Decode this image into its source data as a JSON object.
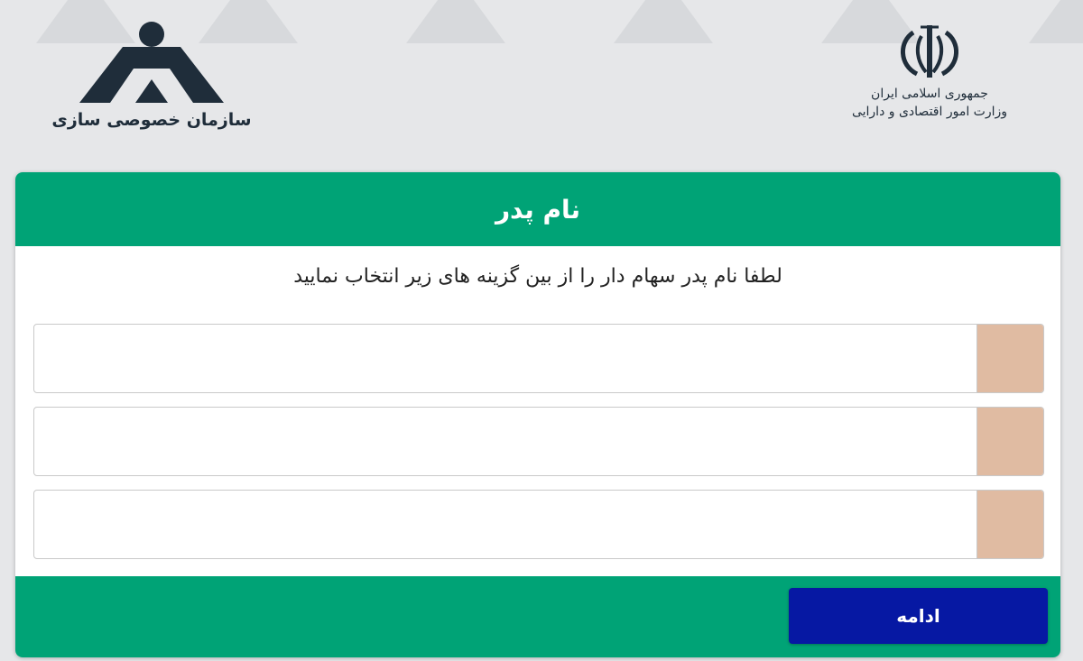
{
  "header": {
    "org_name": "سازمان خصوصی سازی",
    "gov_line1": "جمهوری اسلامی ایران",
    "gov_line2": "وزارت امور اقتصادی و دارایی"
  },
  "card": {
    "title": "نام پدر",
    "instruction": "لطفا نام پدر سهام دار را از بین گزینه های زیر انتخاب نمایید",
    "options": [
      {
        "label": ""
      },
      {
        "label": ""
      },
      {
        "label": ""
      }
    ],
    "continue_label": "ادامه"
  },
  "colors": {
    "primary_green": "#00a376",
    "button_blue": "#0618a3",
    "option_box": "#e0bba2"
  }
}
